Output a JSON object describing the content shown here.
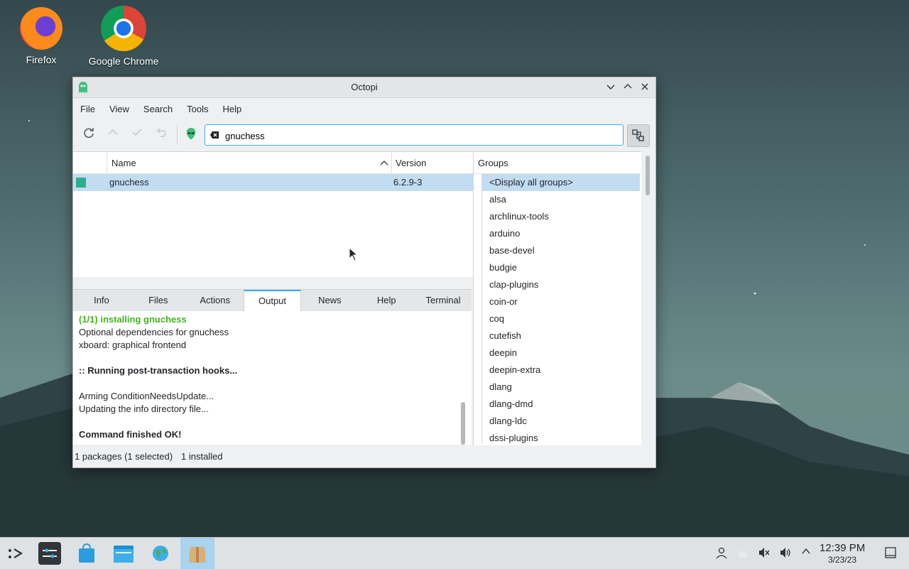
{
  "desktop": {
    "icons": [
      {
        "label": "Firefox"
      },
      {
        "label": "Google Chrome"
      }
    ]
  },
  "window": {
    "title": "Octopi",
    "menu": [
      "File",
      "View",
      "Search",
      "Tools",
      "Help"
    ],
    "search": {
      "value": "gnuchess"
    },
    "table": {
      "headers": {
        "name": "Name",
        "version": "Version"
      },
      "rows": [
        {
          "name": "gnuchess",
          "version": "6.2.9-3"
        }
      ]
    },
    "groups": {
      "header": "Groups",
      "items": [
        "<Display all groups>",
        "alsa",
        "archlinux-tools",
        "arduino",
        "base-devel",
        "budgie",
        "clap-plugins",
        "coin-or",
        "coq",
        "cutefish",
        "deepin",
        "deepin-extra",
        "dlang",
        "dlang-dmd",
        "dlang-ldc",
        "dssi-plugins"
      ]
    },
    "tabs": [
      "Info",
      "Files",
      "Actions",
      "Output",
      "News",
      "Help",
      "Terminal"
    ],
    "active_tab": "Output",
    "output": {
      "lines": [
        "(1/1) installing gnuchess",
        "Optional dependencies for gnuchess",
        "xboard: graphical frontend",
        "",
        ":: Running post-transaction hooks...",
        "",
        "Arming ConditionNeedsUpdate...",
        "Updating the info directory file...",
        "",
        "Command finished OK!"
      ]
    },
    "status": {
      "packages": "1 packages (1 selected)",
      "installed": "1 installed"
    }
  },
  "taskbar": {
    "time": "12:39 PM",
    "date": "3/23/23"
  },
  "colors": {
    "accent": "#3daee9",
    "selection": "#c2dcf2",
    "success": "#44b521"
  }
}
